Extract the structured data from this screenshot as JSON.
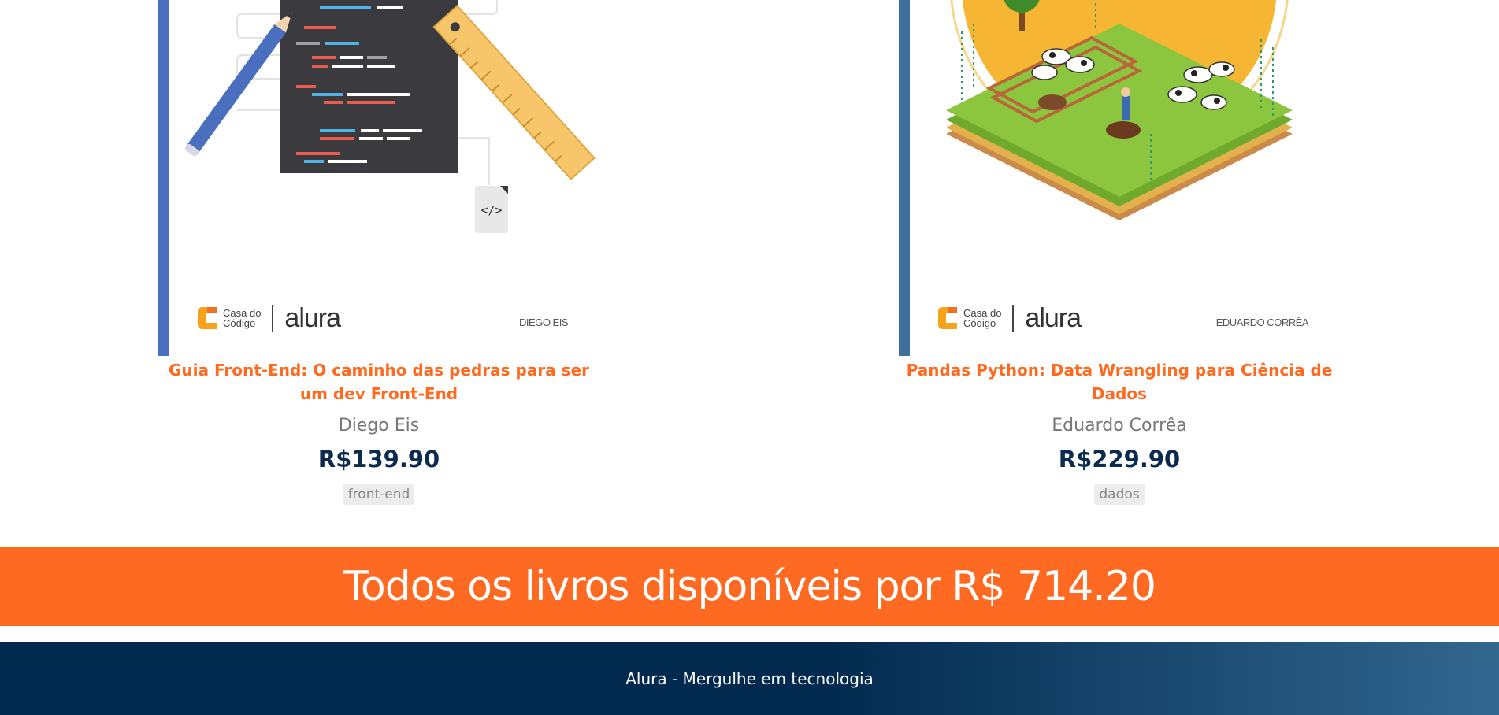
{
  "books": [
    {
      "cover_brand": "Casa do Código",
      "cover_brand_line1": "Casa do",
      "cover_brand_line2": "Código",
      "cover_publisher": "alura",
      "cover_author": "DIEGO EIS",
      "title": "Guia Front-End: O caminho das pedras para ser um dev Front-End",
      "author": "Diego Eis",
      "price": "R$139.90",
      "tag": "front-end"
    },
    {
      "cover_brand": "Casa do Código",
      "cover_brand_line1": "Casa do",
      "cover_brand_line2": "Código",
      "cover_publisher": "alura",
      "cover_author": "EDUARDO CORRÊA",
      "title": "Pandas Python: Data Wrangling para Ciência de Dados",
      "author": "Eduardo Corrêa",
      "price": "R$229.90",
      "tag": "dados"
    }
  ],
  "total_banner": {
    "text": "Todos os livros disponíveis por R$ 714.20"
  },
  "footer": {
    "text": "Alura - Mergulhe em tecnologia"
  },
  "colors": {
    "accent": "#ff6a22",
    "price": "#0b2b4f",
    "footer_dark": "#022a4f",
    "footer_light": "#326790"
  }
}
